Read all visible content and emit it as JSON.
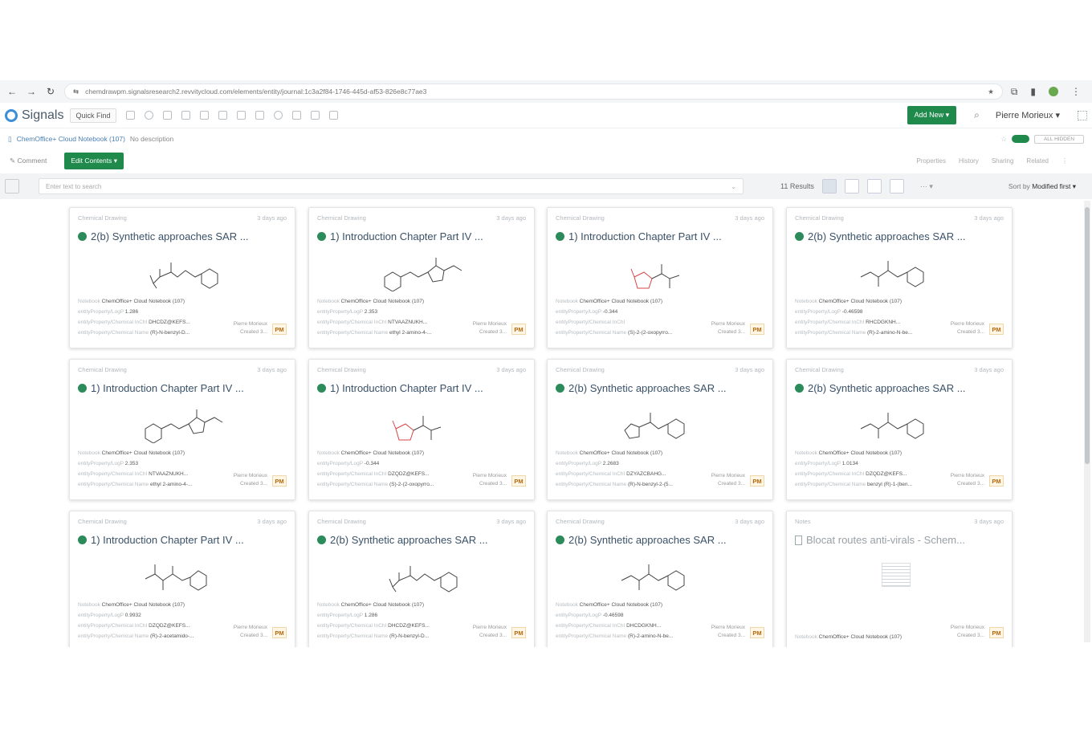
{
  "browser": {
    "url": "chemdrawpm.signalsresearch2.revvitycloud.com/elements/entity/journal:1c3a2f84-1746-445d-af53-826e8c77ae3"
  },
  "app": {
    "logo": "Signals",
    "quick_find": "Quick Find",
    "add_new": "Add New ▾",
    "user": "Pierre Morieux ▾",
    "breadcrumb": "ChemOffice+ Cloud Notebook (107)",
    "breadcrumb_desc": "No description",
    "toggle_label": "ALL HIDDEN",
    "comment": "Comment",
    "edit_contents": "Edit Contents ▾",
    "actions": [
      "Properties",
      "History",
      "Sharing",
      "Related"
    ],
    "filter_placeholder": "Enter text to search",
    "results": "11 Results",
    "sort_prefix": "Sort by",
    "sort_value": "Modified first ▾"
  },
  "cards": [
    {
      "type": "Chemical Drawing",
      "age": "3 days ago",
      "title": "2(b) Synthetic approaches SAR ...",
      "kind": "chem",
      "mol": "a",
      "logp": "1.286",
      "inchi": "DHCDZ@KEFS...",
      "name": "(R)-N-benzyl-D...",
      "badge": "PM"
    },
    {
      "type": "Chemical Drawing",
      "age": "3 days ago",
      "title": "1) Introduction Chapter Part IV ...",
      "kind": "chem",
      "mol": "b",
      "logp": "2.353",
      "inchi": "NTVAAZNUKH...",
      "name": "ethyl 2-amino-4-...",
      "badge": "PM"
    },
    {
      "type": "Chemical Drawing",
      "age": "3 days ago",
      "title": "1) Introduction Chapter Part IV ...",
      "kind": "chem",
      "mol": "c",
      "logp": "-0.344",
      "inchi": "",
      "name": "(S)-2-(2-oxopyrro...",
      "badge": "PM"
    },
    {
      "type": "Chemical Drawing",
      "age": "3 days ago",
      "title": "2(b) Synthetic approaches SAR ...",
      "kind": "chem",
      "mol": "d",
      "logp": "-0.46598",
      "inchi": "RHCDGKNH...",
      "name": "(R)-2-amino-N-be...",
      "badge": "PM"
    },
    {
      "type": "Chemical Drawing",
      "age": "3 days ago",
      "title": "1) Introduction Chapter Part IV ...",
      "kind": "chem",
      "mol": "b",
      "logp": "2.353",
      "inchi": "NTVAAZNUKH...",
      "name": "ethyl 2-amino-4-...",
      "badge": "PM"
    },
    {
      "type": "Chemical Drawing",
      "age": "3 days ago",
      "title": "1) Introduction Chapter Part IV ...",
      "kind": "chem",
      "mol": "c",
      "logp": "-0.344",
      "inchi": "DZQDZ@KEFS...",
      "name": "(S)-2-(2-oxopyrro...",
      "badge": "PM"
    },
    {
      "type": "Chemical Drawing",
      "age": "3 days ago",
      "title": "2(b) Synthetic approaches SAR ...",
      "kind": "chem",
      "mol": "e",
      "logp": "2.2683",
      "inchi": "DZYAZCBAHG...",
      "name": "(R)-N-benzyl-2-(5...",
      "badge": "PM"
    },
    {
      "type": "Chemical Drawing",
      "age": "3 days ago",
      "title": "2(b) Synthetic approaches SAR ...",
      "kind": "chem",
      "mol": "d",
      "logp": "1.0134",
      "inchi": "DZQDZ@KEFS...",
      "name": "benzyl (R)-1-(ben...",
      "badge": "PM"
    },
    {
      "type": "Chemical Drawing",
      "age": "3 days ago",
      "title": "1) Introduction Chapter Part IV ...",
      "kind": "chem",
      "mol": "f",
      "logp": "0.9932",
      "inchi": "DZQDZ@KEFS...",
      "name": "(R)-2-acetamido-...",
      "badge": "PM"
    },
    {
      "type": "Chemical Drawing",
      "age": "3 days ago",
      "title": "2(b) Synthetic approaches SAR ...",
      "kind": "chem",
      "mol": "a",
      "logp": "1.286",
      "inchi": "DHCDZ@KEFS...",
      "name": "(R)-N-benzyl-D...",
      "badge": "PM"
    },
    {
      "type": "Chemical Drawing",
      "age": "3 days ago",
      "title": "2(b) Synthetic approaches SAR ...",
      "kind": "chem",
      "mol": "d",
      "logp": "-0.46598",
      "inchi": "DHCDGKNH...",
      "name": "(R)-2-amino-N-be...",
      "badge": "PM"
    },
    {
      "type": "Notes",
      "age": "3 days ago",
      "title": "Blocat routes anti-virals - Schem...",
      "kind": "note",
      "badge": "PM"
    }
  ],
  "meta_labels": {
    "notebook_key": "Notebook",
    "notebook_value": "ChemOffice+ Cloud Notebook (107)",
    "logp_key": "entityProperty/LogP",
    "inchi_key": "entityProperty/Chemical InChI",
    "name_key": "entityProperty/Chemical Name",
    "owner": "Pierre Morieux",
    "created": "Created 3..."
  }
}
